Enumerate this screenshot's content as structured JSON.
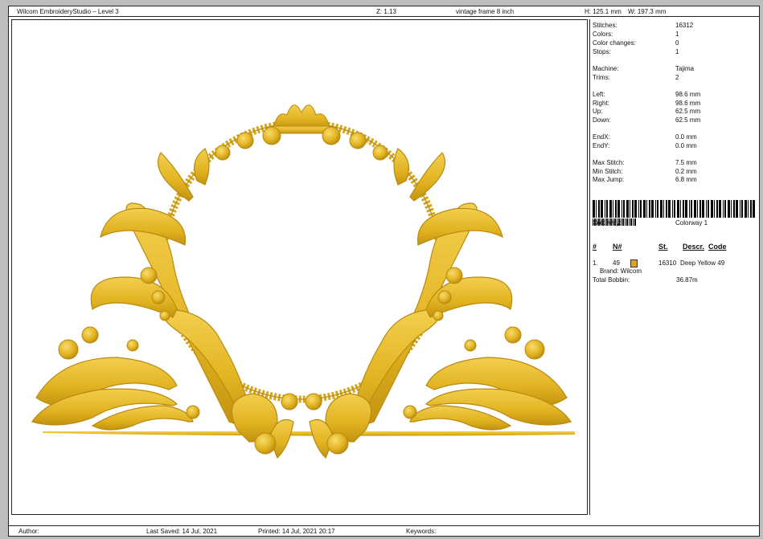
{
  "header": {
    "app_title": "Wilcom EmbroideryStudio – Level 3",
    "zoom": "Z: 1.13",
    "design_name": "vintage frame 8  inch",
    "height": "H: 125.1 mm",
    "width": "W: 197.3 mm"
  },
  "info": {
    "stats": [
      {
        "label": "Stitches:",
        "value": "16312"
      },
      {
        "label": "Colors:",
        "value": "1"
      },
      {
        "label": "Color changes:",
        "value": "0"
      },
      {
        "label": "Stops:",
        "value": "1"
      },
      {
        "label": "Machine:",
        "value": "Tajima"
      },
      {
        "label": "Trims:",
        "value": "2"
      },
      {
        "label": "Left:",
        "value": "98.6 mm"
      },
      {
        "label": "Right:",
        "value": "98.6 mm"
      },
      {
        "label": "Up:",
        "value": "62.5 mm"
      },
      {
        "label": "Down:",
        "value": "62.5 mm"
      },
      {
        "label": "EndX:",
        "value": "0.0 mm"
      },
      {
        "label": "EndY:",
        "value": "0.0 mm"
      },
      {
        "label": "Max Stitch:",
        "value": "7.5 mm"
      },
      {
        "label": "Min Stitch:",
        "value": "0.2 mm"
      },
      {
        "label": "Max Jump:",
        "value": "6.8 mm"
      }
    ],
    "colorway_label": "Colorway:",
    "colorway_value": "Colorway 1",
    "columns": {
      "num": "#",
      "n": "N#",
      "st": "St.",
      "descr": "Descr.",
      "code": "Code"
    },
    "thread": {
      "index": "1.",
      "n": "49",
      "color": "#e0a41c",
      "stitches": "16310",
      "description": "Deep Yellow 49",
      "brand": "Brand: Wilcom"
    },
    "total_bobbin_label": "Total Bobbin:",
    "total_bobbin_value": "36.87m"
  },
  "footer": {
    "author": "Author:",
    "last_saved": "Last Saved:  14 Jul, 2021",
    "printed": "Printed:  14 Jul, 2021 20:17",
    "keywords": "Keywords:"
  },
  "design": {
    "thread_color": "#e2b321",
    "shadow_color": "#b88a12",
    "highlight_color": "#f6d35a"
  }
}
